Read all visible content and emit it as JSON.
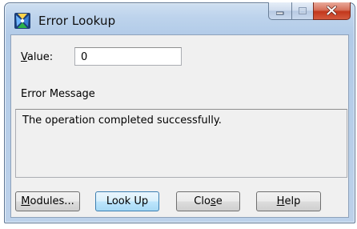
{
  "window": {
    "title": "Error Lookup",
    "buttons": {
      "minimize": "minimize",
      "maximize": "maximize",
      "close": "close"
    }
  },
  "value": {
    "label_prefix": "",
    "label_accel": "V",
    "label_rest": "alue:",
    "current_value": "0"
  },
  "error_message": {
    "label": "Error Message",
    "text": "The operation completed successfully."
  },
  "buttons": {
    "modules": {
      "accel": "M",
      "rest": "odules..."
    },
    "lookup": {
      "text": "Look Up"
    },
    "close": {
      "pre": "Clo",
      "accel": "s",
      "post": "e"
    },
    "help": {
      "accel": "H",
      "rest": "elp"
    }
  },
  "icons": {
    "app": "error-lookup-app-icon",
    "minimize": "minimize-icon",
    "maximize": "maximize-icon",
    "close": "close-icon"
  },
  "colors": {
    "title_bar": "#bdd3ec",
    "close_button": "#c2371c",
    "default_button": "#3c7fb1",
    "client_bg": "#f0f0f0"
  }
}
